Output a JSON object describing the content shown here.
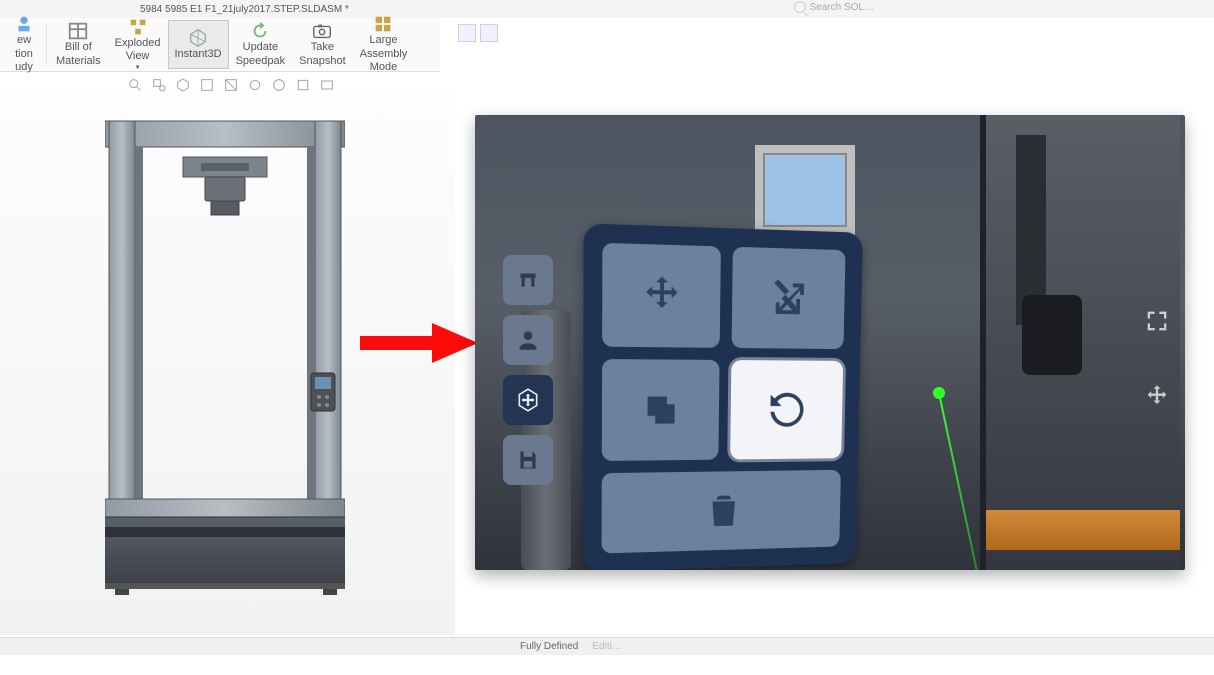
{
  "title": "5984 5985 E1 F1_21july2017.STEP.SLDASM *",
  "search_placeholder": "Search SOL…",
  "ribbon": [
    {
      "label1": "ew",
      "label2": "tion",
      "label3": "udy"
    },
    {
      "label1": "Bill of",
      "label2": "Materials",
      "label3": ""
    },
    {
      "label1": "Exploded",
      "label2": "View",
      "label3": ""
    },
    {
      "label1": "Instant3D",
      "label2": "",
      "label3": ""
    },
    {
      "label1": "Update",
      "label2": "Speedpak",
      "label3": ""
    },
    {
      "label1": "Take",
      "label2": "Snapshot",
      "label3": ""
    },
    {
      "label1": "Large",
      "label2": "Assembly",
      "label3": "Mode"
    }
  ],
  "status": {
    "state": "Fully Defined",
    "extra": "Editi…"
  },
  "vr": {
    "sidebar": [
      "furniture-icon",
      "user-icon",
      "move-cube-icon",
      "save-icon"
    ],
    "tiles": [
      "move-icon",
      "scale-icon",
      "copy-icon",
      "rotate-icon",
      "trash-icon"
    ]
  }
}
